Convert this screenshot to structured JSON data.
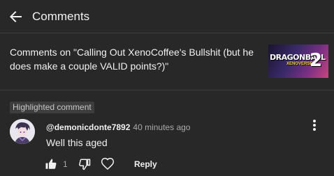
{
  "header": {
    "title": "Comments",
    "back_icon": "arrow-left-icon"
  },
  "video": {
    "title": "Comments on \"Calling Out XenoCoffee's Bullshit (but he does make a couple VALID points?)\"",
    "thumbnail_logo": "DRAGONBALL",
    "thumbnail_sub": "XENOVERSE",
    "thumbnail_number": "2"
  },
  "comment": {
    "badge": "Highlighted comment",
    "author": "@demonicdonte7892",
    "time": "40 minutes ago",
    "text": "Well this aged",
    "like_count": "1",
    "reply_label": "Reply",
    "icons": {
      "like": "thumbs-up-icon",
      "dislike": "thumbs-down-icon",
      "heart": "heart-icon",
      "more": "more-vertical-icon"
    }
  },
  "colors": {
    "background": "#282828",
    "text": "#f1f1f1",
    "secondary_text": "#aaaaaa",
    "badge_bg": "#3d3d3d"
  }
}
